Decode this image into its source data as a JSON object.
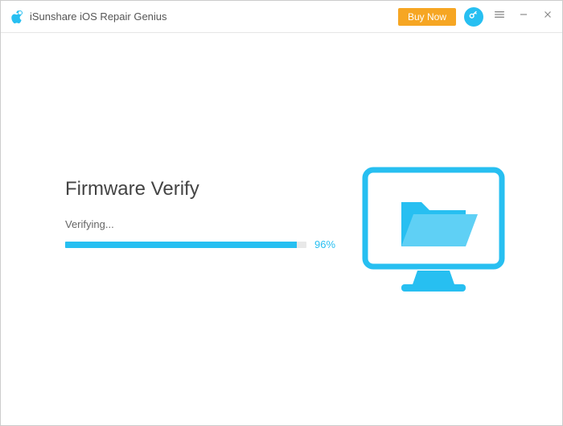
{
  "app": {
    "title": "iSunshare iOS Repair Genius"
  },
  "titlebar": {
    "buy_now_label": "Buy Now"
  },
  "main": {
    "heading": "Firmware Verify",
    "status": "Verifying...",
    "progress_percent": 96,
    "progress_label": "96%"
  },
  "colors": {
    "accent": "#27bff1",
    "buy_now": "#f6a623"
  },
  "icons": {
    "logo": "apple-tool-icon",
    "key": "key-icon",
    "menu": "hamburger-icon",
    "minimize": "minimize-icon",
    "close": "close-icon",
    "illustration": "monitor-folder-icon"
  }
}
